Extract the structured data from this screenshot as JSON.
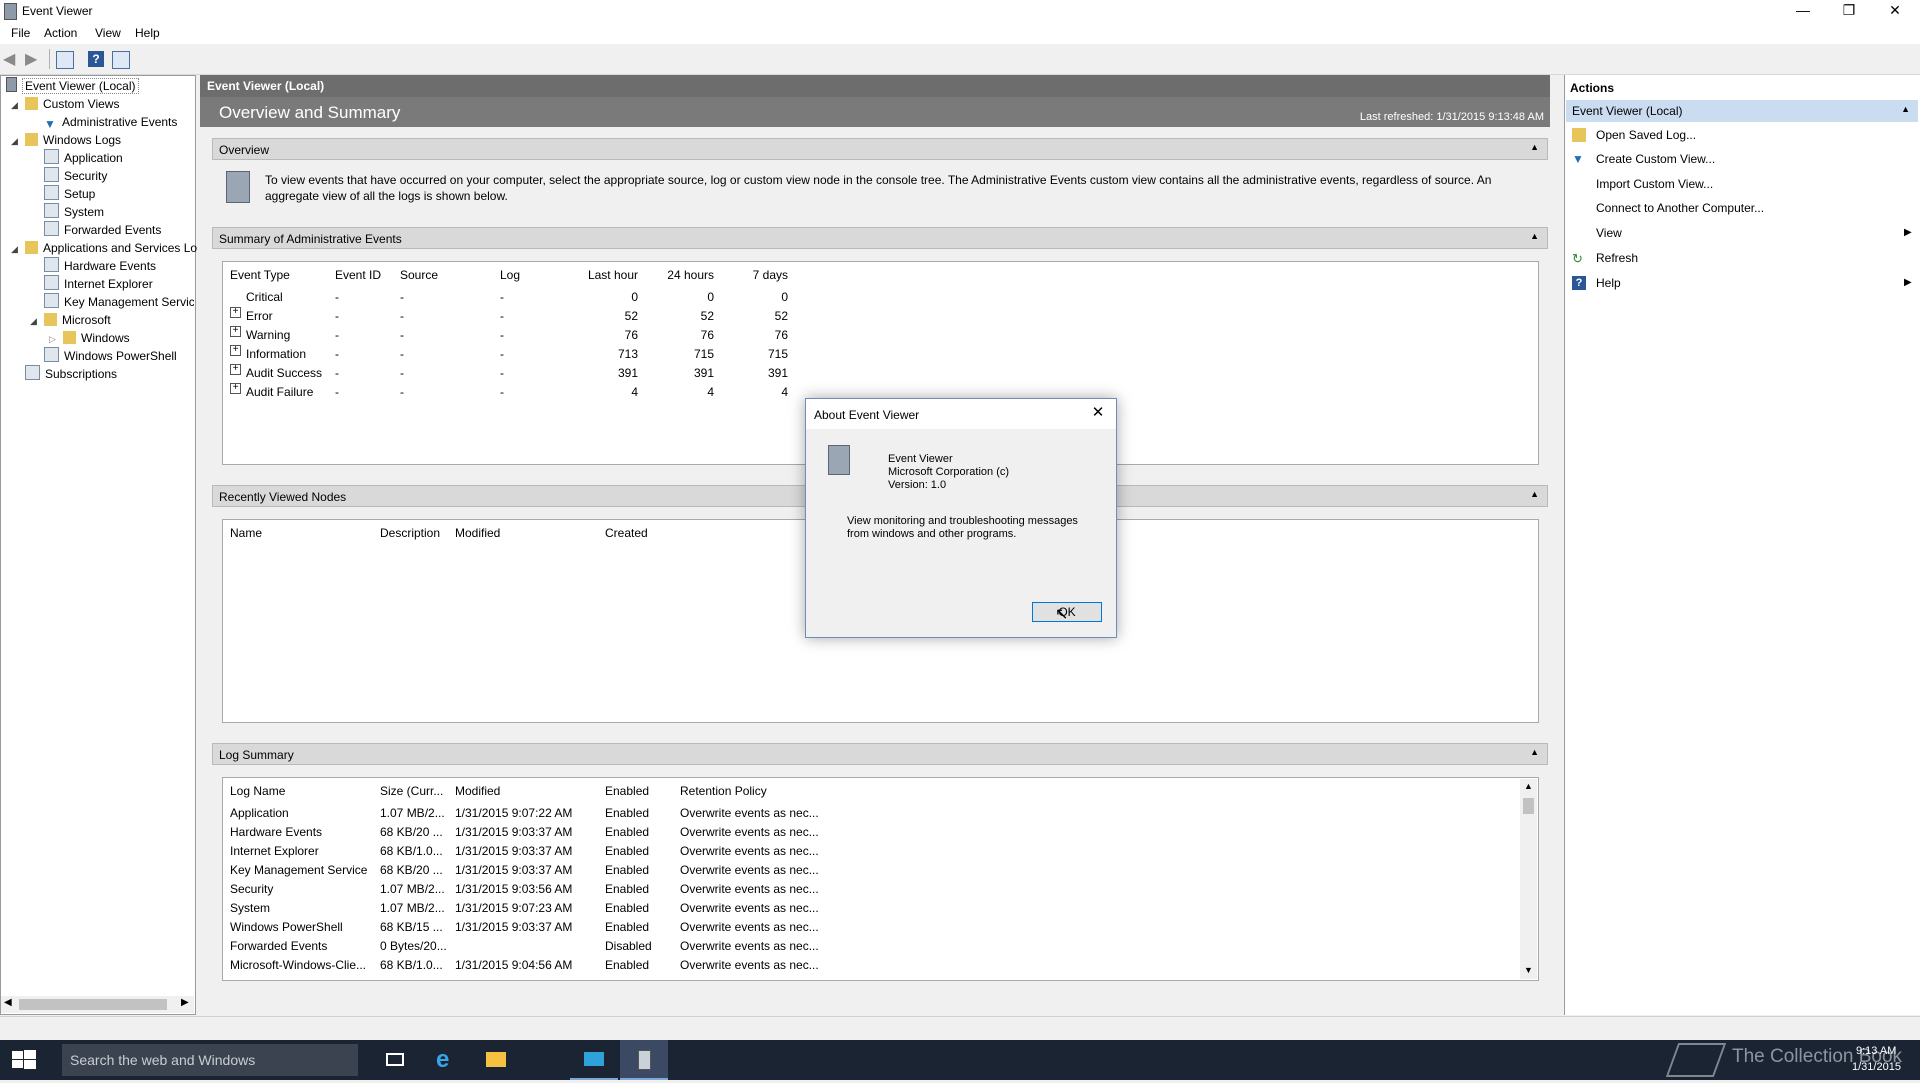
{
  "window": {
    "title": "Event Viewer"
  },
  "menu": [
    "File",
    "Action",
    "View",
    "Help"
  ],
  "tree": {
    "root": "Event Viewer (Local)",
    "custom_views": "Custom Views",
    "admin_events": "Administrative Events",
    "windows_logs": "Windows Logs",
    "logs": [
      "Application",
      "Security",
      "Setup",
      "System",
      "Forwarded Events"
    ],
    "apps_services": "Applications and Services Lo",
    "apps_children": [
      "Hardware Events",
      "Internet Explorer",
      "Key Management Service"
    ],
    "microsoft": "Microsoft",
    "windows": "Windows",
    "powershell": "Windows PowerShell",
    "subscriptions": "Subscriptions"
  },
  "center": {
    "header": "Event Viewer (Local)",
    "title": "Overview and Summary",
    "last_refreshed": "Last refreshed: 1/31/2015 9:13:48 AM",
    "overview_label": "Overview",
    "overview_text_1": "To view events that have occurred on your computer, select the appropriate source, log or custom view node in the console tree. The Administrative Events custom view contains all the administrative events, regardless of source. An",
    "overview_text_2": "aggregate view of all the logs is shown below.",
    "summary_label": "Summary of Administrative Events",
    "summary_columns": [
      "Event Type",
      "Event ID",
      "Source",
      "Log",
      "Last hour",
      "24 hours",
      "7 days"
    ],
    "summary_rows": [
      [
        "Critical",
        "-",
        "-",
        "-",
        "0",
        "0",
        "0"
      ],
      [
        "Error",
        "-",
        "-",
        "-",
        "52",
        "52",
        "52"
      ],
      [
        "Warning",
        "-",
        "-",
        "-",
        "76",
        "76",
        "76"
      ],
      [
        "Information",
        "-",
        "-",
        "-",
        "713",
        "715",
        "715"
      ],
      [
        "Audit Success",
        "-",
        "-",
        "-",
        "391",
        "391",
        "391"
      ],
      [
        "Audit Failure",
        "-",
        "-",
        "-",
        "4",
        "4",
        "4"
      ]
    ],
    "recent_label": "Recently Viewed Nodes",
    "recent_columns": [
      "Name",
      "Description",
      "Modified",
      "Created"
    ],
    "log_label": "Log Summary",
    "log_columns": [
      "Log Name",
      "Size (Curr...",
      "Modified",
      "Enabled",
      "Retention Policy"
    ],
    "log_rows": [
      [
        "Application",
        "1.07 MB/2...",
        "1/31/2015 9:07:22 AM",
        "Enabled",
        "Overwrite events as nec..."
      ],
      [
        "Hardware Events",
        "68 KB/20 ...",
        "1/31/2015 9:03:37 AM",
        "Enabled",
        "Overwrite events as nec..."
      ],
      [
        "Internet Explorer",
        "68 KB/1.0...",
        "1/31/2015 9:03:37 AM",
        "Enabled",
        "Overwrite events as nec..."
      ],
      [
        "Key Management Service",
        "68 KB/20 ...",
        "1/31/2015 9:03:37 AM",
        "Enabled",
        "Overwrite events as nec..."
      ],
      [
        "Security",
        "1.07 MB/2...",
        "1/31/2015 9:03:56 AM",
        "Enabled",
        "Overwrite events as nec..."
      ],
      [
        "System",
        "1.07 MB/2...",
        "1/31/2015 9:07:23 AM",
        "Enabled",
        "Overwrite events as nec..."
      ],
      [
        "Windows PowerShell",
        "68 KB/15 ...",
        "1/31/2015 9:03:37 AM",
        "Enabled",
        "Overwrite events as nec..."
      ],
      [
        "Forwarded Events",
        "0 Bytes/20...",
        "",
        "Disabled",
        "Overwrite events as nec..."
      ],
      [
        "Microsoft-Windows-Clie...",
        "68 KB/1.0...",
        "1/31/2015 9:04:56 AM",
        "Enabled",
        "Overwrite events as nec..."
      ]
    ]
  },
  "actions": {
    "title": "Actions",
    "section": "Event Viewer (Local)",
    "items": [
      "Open Saved Log...",
      "Create Custom View...",
      "Import Custom View...",
      "Connect to Another Computer...",
      "View",
      "Refresh",
      "Help"
    ]
  },
  "dialog": {
    "title": "About Event Viewer",
    "app_name": "Event Viewer",
    "company": "Microsoft Corporation (c)",
    "version": "Version: 1.0",
    "desc_1": "View monitoring and troubleshooting messages",
    "desc_2": "from windows and other programs.",
    "ok": "OK"
  },
  "taskbar": {
    "search_placeholder": "Search the web and Windows",
    "time": "9:13 AM",
    "date": "1/31/2015",
    "watermark": "The Collection Book"
  }
}
